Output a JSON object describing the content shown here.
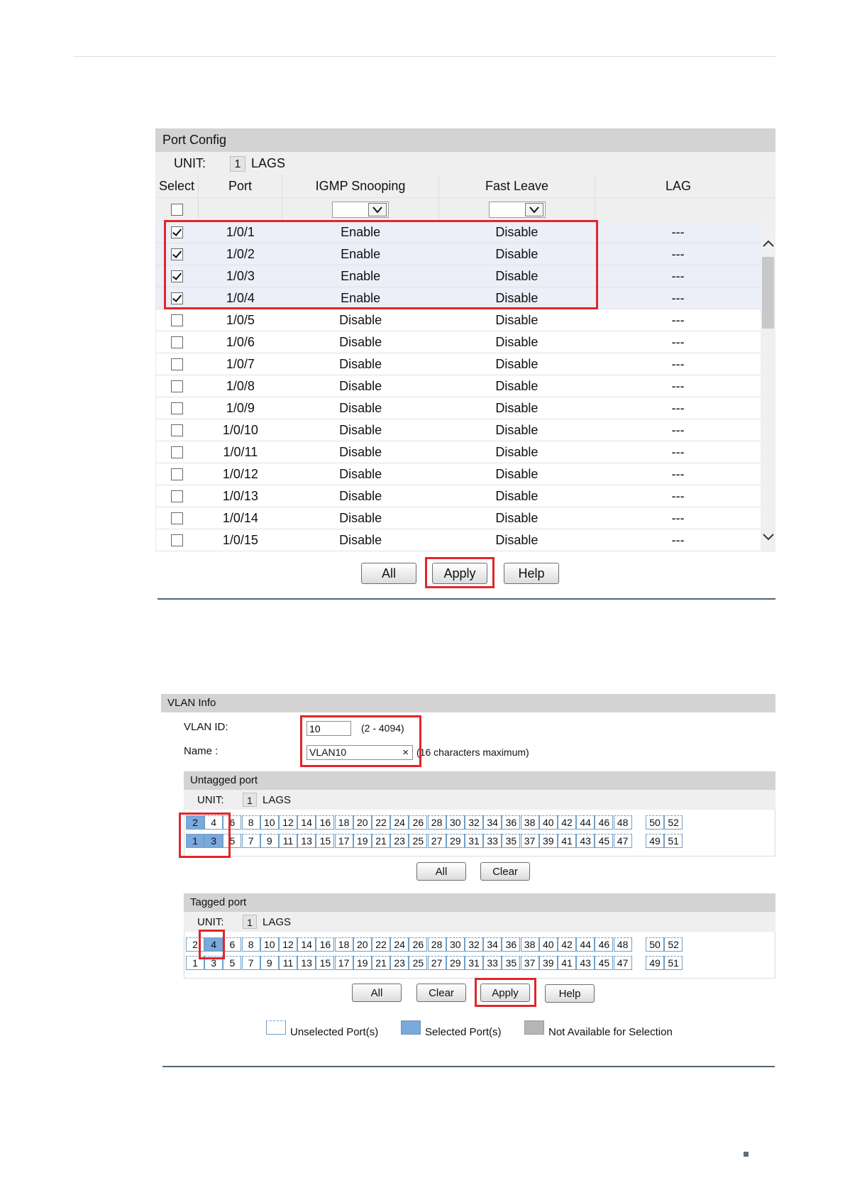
{
  "port_config": {
    "title": "Port Config",
    "unit_label": "UNIT:",
    "unit_value": "1",
    "lags_label": "LAGS",
    "columns": [
      "Select",
      "Port",
      "IGMP Snooping",
      "Fast Leave",
      "LAG"
    ],
    "rows": [
      {
        "port": "1/0/1",
        "igmp": "Enable",
        "fast_leave": "Disable",
        "lag": "---",
        "checked": true
      },
      {
        "port": "1/0/2",
        "igmp": "Enable",
        "fast_leave": "Disable",
        "lag": "---",
        "checked": true
      },
      {
        "port": "1/0/3",
        "igmp": "Enable",
        "fast_leave": "Disable",
        "lag": "---",
        "checked": true
      },
      {
        "port": "1/0/4",
        "igmp": "Enable",
        "fast_leave": "Disable",
        "lag": "---",
        "checked": true
      },
      {
        "port": "1/0/5",
        "igmp": "Disable",
        "fast_leave": "Disable",
        "lag": "---",
        "checked": false
      },
      {
        "port": "1/0/6",
        "igmp": "Disable",
        "fast_leave": "Disable",
        "lag": "---",
        "checked": false
      },
      {
        "port": "1/0/7",
        "igmp": "Disable",
        "fast_leave": "Disable",
        "lag": "---",
        "checked": false
      },
      {
        "port": "1/0/8",
        "igmp": "Disable",
        "fast_leave": "Disable",
        "lag": "---",
        "checked": false
      },
      {
        "port": "1/0/9",
        "igmp": "Disable",
        "fast_leave": "Disable",
        "lag": "---",
        "checked": false
      },
      {
        "port": "1/0/10",
        "igmp": "Disable",
        "fast_leave": "Disable",
        "lag": "---",
        "checked": false
      },
      {
        "port": "1/0/11",
        "igmp": "Disable",
        "fast_leave": "Disable",
        "lag": "---",
        "checked": false
      },
      {
        "port": "1/0/12",
        "igmp": "Disable",
        "fast_leave": "Disable",
        "lag": "---",
        "checked": false
      },
      {
        "port": "1/0/13",
        "igmp": "Disable",
        "fast_leave": "Disable",
        "lag": "---",
        "checked": false
      },
      {
        "port": "1/0/14",
        "igmp": "Disable",
        "fast_leave": "Disable",
        "lag": "---",
        "checked": false
      },
      {
        "port": "1/0/15",
        "igmp": "Disable",
        "fast_leave": "Disable",
        "lag": "---",
        "checked": false
      }
    ],
    "buttons": {
      "all": "All",
      "apply": "Apply",
      "help": "Help"
    }
  },
  "vlan_info": {
    "title": "VLAN Info",
    "vlan_id_label": "VLAN ID:",
    "vlan_id_value": "10",
    "vlan_id_range": "(2 - 4094)",
    "name_label": "Name :",
    "name_value": "VLAN10",
    "name_clear": "×",
    "name_hint": "(16 characters maximum)",
    "untagged": {
      "title": "Untagged port",
      "unit_label": "UNIT:",
      "unit_value": "1",
      "lags_label": "LAGS",
      "top_ports": [
        "2",
        "4",
        "6",
        "8",
        "10",
        "12",
        "14",
        "16",
        "18",
        "20",
        "22",
        "24",
        "26",
        "28",
        "30",
        "32",
        "34",
        "36",
        "38",
        "40",
        "42",
        "44",
        "46",
        "48"
      ],
      "bottom_ports": [
        "1",
        "3",
        "5",
        "7",
        "9",
        "11",
        "13",
        "15",
        "17",
        "19",
        "21",
        "23",
        "25",
        "27",
        "29",
        "31",
        "33",
        "35",
        "37",
        "39",
        "41",
        "43",
        "45",
        "47"
      ],
      "extra_top": [
        "50",
        "52"
      ],
      "extra_bottom": [
        "49",
        "51"
      ],
      "selected": [
        "1",
        "2",
        "3"
      ],
      "buttons": {
        "all": "All",
        "clear": "Clear"
      }
    },
    "tagged": {
      "title": "Tagged port",
      "unit_label": "UNIT:",
      "unit_value": "1",
      "lags_label": "LAGS",
      "top_ports": [
        "2",
        "4",
        "6",
        "8",
        "10",
        "12",
        "14",
        "16",
        "18",
        "20",
        "22",
        "24",
        "26",
        "28",
        "30",
        "32",
        "34",
        "36",
        "38",
        "40",
        "42",
        "44",
        "46",
        "48"
      ],
      "bottom_ports": [
        "1",
        "3",
        "5",
        "7",
        "9",
        "11",
        "13",
        "15",
        "17",
        "19",
        "21",
        "23",
        "25",
        "27",
        "29",
        "31",
        "33",
        "35",
        "37",
        "39",
        "41",
        "43",
        "45",
        "47"
      ],
      "extra_top": [
        "50",
        "52"
      ],
      "extra_bottom": [
        "49",
        "51"
      ],
      "selected": [
        "4"
      ],
      "buttons": {
        "all": "All",
        "clear": "Clear",
        "apply": "Apply",
        "help": "Help"
      }
    },
    "legend": {
      "unselected": "Unselected Port(s)",
      "selected": "Selected Port(s)",
      "not_available": "Not Available for Selection"
    }
  },
  "colors": {
    "highlight_red": "#e0262b",
    "selected_port": "#7aa9dc",
    "header_gray": "#d3d3d3"
  }
}
